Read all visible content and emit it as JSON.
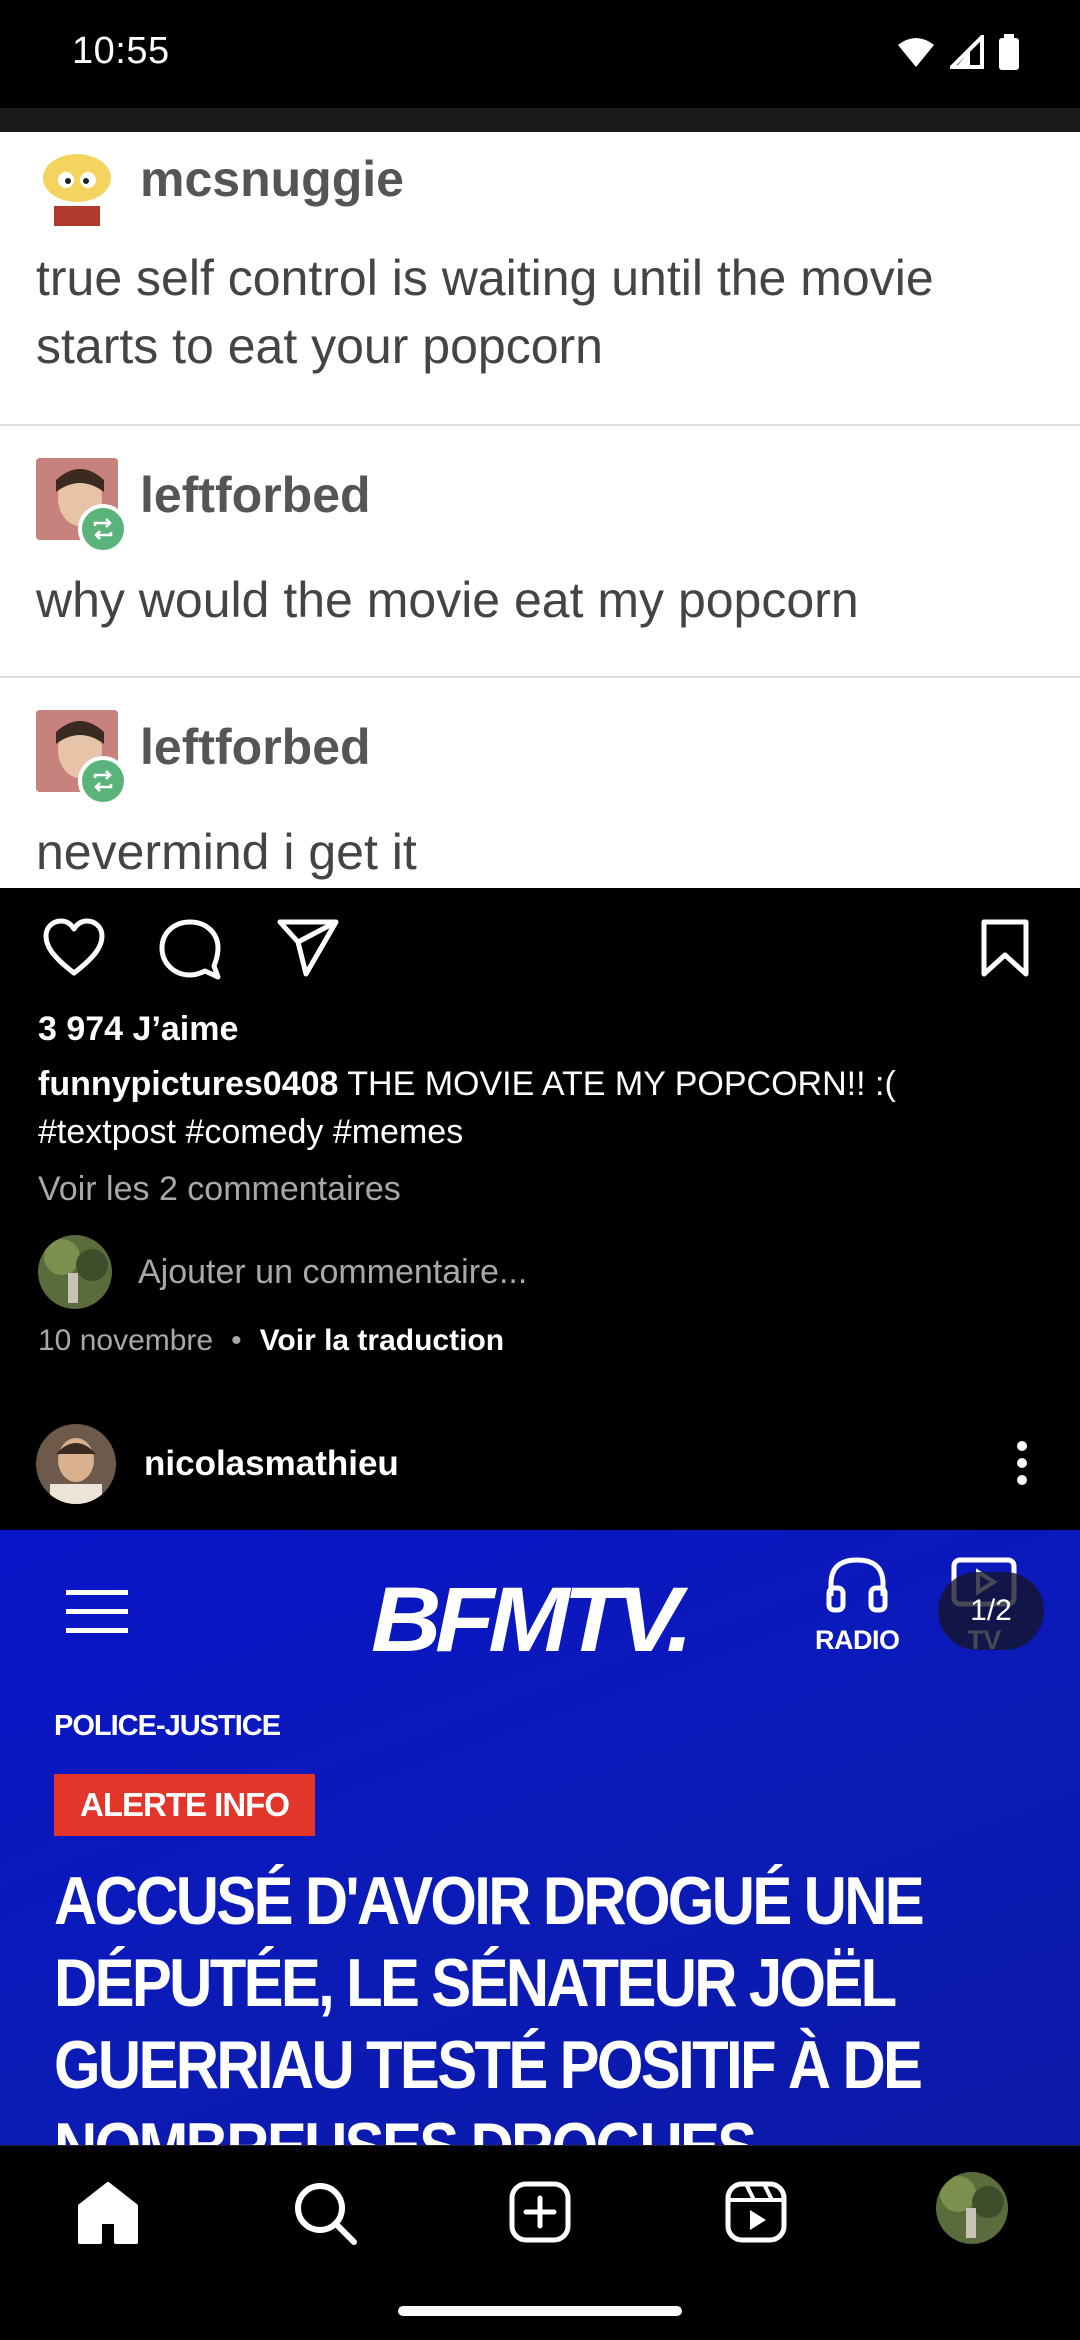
{
  "status_bar": {
    "time": "10:55"
  },
  "post1": {
    "image_textpost": {
      "entries": [
        {
          "user": "mcsnuggie",
          "text": "true self control is waiting until the movie starts to eat your popcorn"
        },
        {
          "user": "leftforbed",
          "text": "why would the movie eat my popcorn"
        },
        {
          "user": "leftforbed",
          "text": "nevermind i get it"
        }
      ]
    },
    "likes": "3 974 J’aime",
    "caption_user": "funnypictures0408",
    "caption_text": " THE MOVIE ATE MY POPCORN!! :( #textpost #comedy #memes",
    "view_comments": "Voir les 2 commentaires",
    "add_comment_placeholder": "Ajouter un commentaire...",
    "date": "10 novembre",
    "dot": "•",
    "translate": "Voir la traduction"
  },
  "post2": {
    "username": "nicolasmathieu",
    "image": {
      "logo": "BFMTV.",
      "radio_label": "RADIO",
      "tv_label": "TV",
      "counter": "1/2",
      "category": "POLICE-JUSTICE",
      "alert": "ALERTE INFO",
      "headline": "ACCUSÉ D'AVOIR DROGUÉ UNE\nDÉPUTÉE, LE SÉNATEUR JOËL\nGUERRIAU TESTÉ POSITIF À DE\nNOMBREUSES DROGUES"
    }
  },
  "colors": {
    "bfm_blue": "#0a14c8",
    "alert_red": "#e2362b",
    "reblog_green": "#5ab37a"
  },
  "icons": [
    "wifi-icon",
    "signal-icon",
    "battery-icon",
    "heart-icon",
    "comment-icon",
    "share-icon",
    "bookmark-icon",
    "more-icon",
    "home-icon",
    "search-icon",
    "create-icon",
    "reels-icon",
    "headphones-icon",
    "play-icon",
    "hamburger-icon"
  ]
}
